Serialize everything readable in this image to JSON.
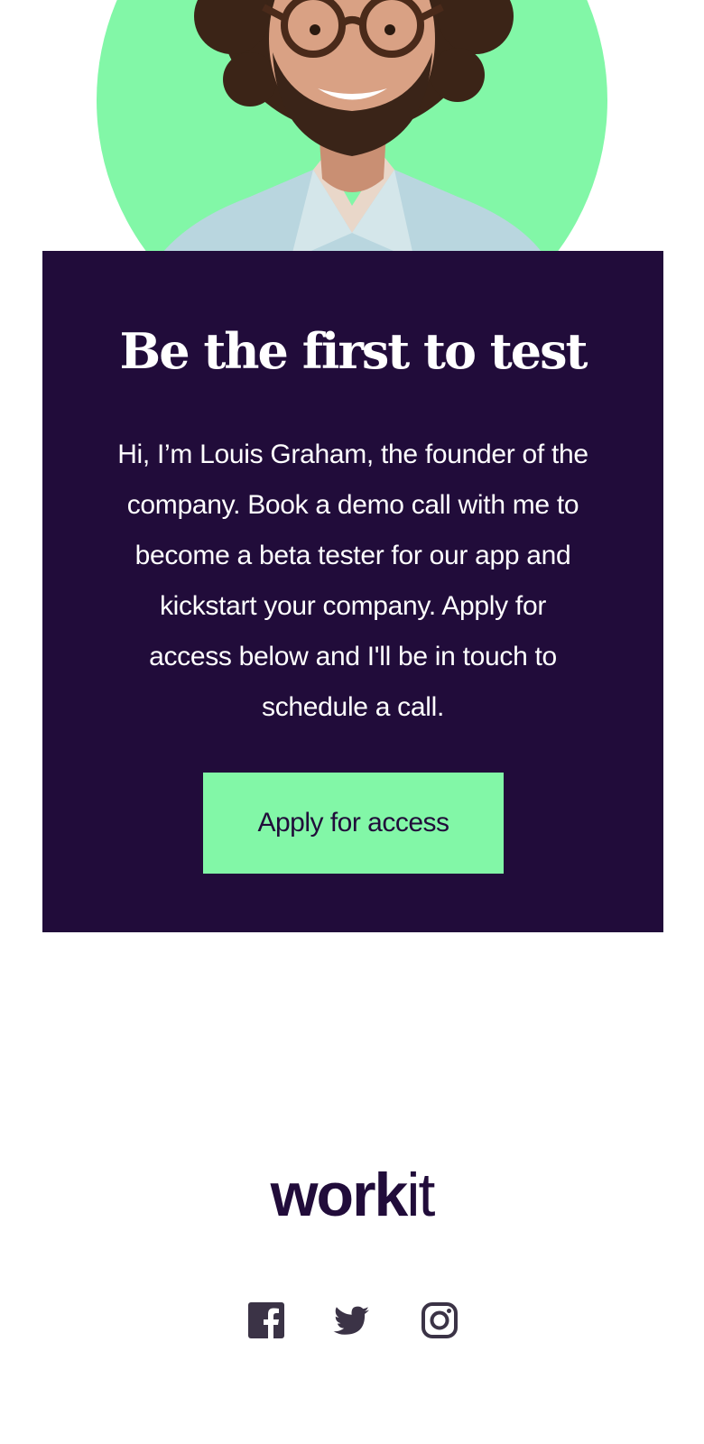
{
  "hero": {
    "portrait_alt": "Louis Graham",
    "portrait_bg_color": "#82f7a7"
  },
  "cta": {
    "title": "Be the first to test",
    "body": "Hi, I’m Louis Graham, the founder of the company. Book a demo call with me to become a beta tester for our app and kickstart your company. Apply for access below and I'll be in touch to schedule a call.",
    "button_label": "Apply for access",
    "background_color": "#210c3a",
    "button_color": "#82f7a7"
  },
  "footer": {
    "logo_bold": "work",
    "logo_light": "it",
    "social_icons": [
      "facebook-icon",
      "twitter-icon",
      "instagram-icon"
    ]
  }
}
